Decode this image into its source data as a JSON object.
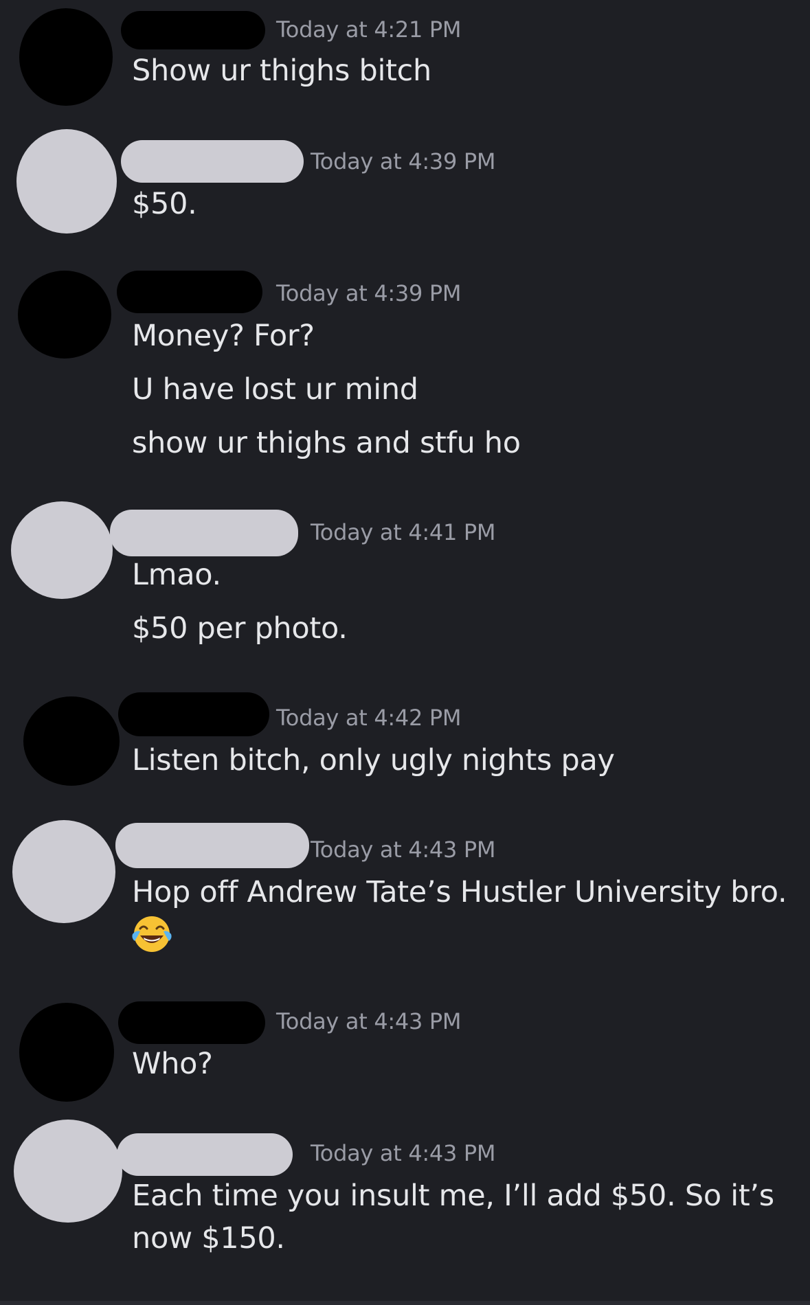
{
  "messages": [
    {
      "time": "Today at 4:21 PM",
      "lines": [
        "Show ur thighs bitch"
      ]
    },
    {
      "time": "Today at 4:39 PM",
      "lines": [
        "$50."
      ]
    },
    {
      "time": "Today at 4:39 PM",
      "lines": [
        "Money? For?",
        "U have lost ur mind",
        "show ur thighs and stfu ho"
      ]
    },
    {
      "time": "Today at 4:41 PM",
      "lines": [
        "Lmao.",
        "$50 per photo."
      ]
    },
    {
      "time": "Today at 4:42 PM",
      "lines": [
        "Listen bitch, only ugly nights pay"
      ]
    },
    {
      "time": "Today at 4:43 PM",
      "lines": [
        "Hop off Andrew Tate’s Hustler University bro."
      ],
      "emoji": "face-with-tears-of-joy-icon"
    },
    {
      "time": "Today at 4:43 PM",
      "lines": [
        "Who?"
      ]
    },
    {
      "time": "Today at 4:43 PM",
      "lines": [
        "Each time you insult me, I’ll add $50. So it’s",
        "now $150."
      ]
    }
  ],
  "colors": {
    "background": "#1e1f24",
    "text": "#e6e7ea",
    "timestamp": "#9a9ca6",
    "redaction_black": "#000000",
    "redaction_white": "#cdccd3"
  }
}
